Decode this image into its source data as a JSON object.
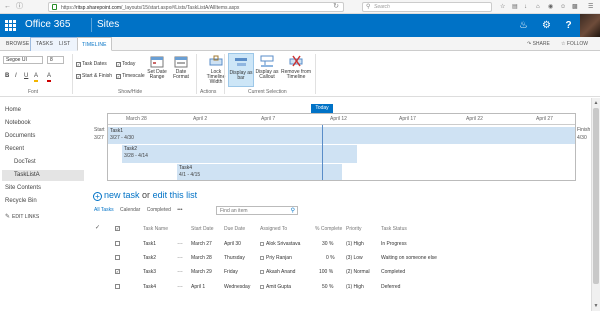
{
  "browser": {
    "url_prefix": "https://",
    "url_host": "ritsp.sharepoint.com",
    "url_path": "/_layouts/15/start.aspx#/Lists/TaskListA/AllItems.aspx",
    "search_placeholder": "Search"
  },
  "suite": {
    "app_name": "Office 365",
    "site_label": "Sites",
    "notification_count": "1",
    "settings_icon": "gear-icon",
    "help_icon": "?"
  },
  "ribbon_tabs": {
    "browse": "BROWSE",
    "tasks": "TASKS",
    "list": "LIST",
    "timeline": "TIMELINE",
    "share": "SHARE",
    "follow": "FOLLOW"
  },
  "ribbon": {
    "font_name": "Segoe UI",
    "font_size": "8",
    "format_labels": [
      "B",
      "I",
      "U",
      "A"
    ],
    "show_hide": {
      "task_dates": "Task Dates",
      "today": "Today",
      "start_finish": "Start & Finish",
      "timescale": "Timescale"
    },
    "buttons": {
      "set_date_range": "Set Date Range",
      "date_format": "Date Format",
      "lock_width": "Lock Timeline Width",
      "display_as_bar": "Display as bar",
      "display_as_callout": "Display as Callout",
      "remove_from_timeline": "Remove from Timeline"
    },
    "groups": {
      "font": "Font",
      "show_hide": "Show/Hide",
      "actions": "Actions",
      "current_selection": "Current Selection"
    }
  },
  "leftnav": {
    "items": [
      "Home",
      "Notebook",
      "Documents",
      "Recent",
      "DocTest",
      "TaskListA",
      "Site Contents",
      "Recycle Bin"
    ],
    "edit_links": "EDIT LINKS"
  },
  "timeline": {
    "today_label": "Today",
    "start_label": "Start",
    "start_date": "3/27",
    "finish_label": "Finish",
    "finish_date": "4/30",
    "dates": [
      "March 28",
      "April 2",
      "April 7",
      "April 12",
      "April 17",
      "April 22",
      "April 27"
    ],
    "tasks": [
      {
        "name": "Task1",
        "dates": "3/27 - 4/30"
      },
      {
        "name": "Task2",
        "dates": "3/28 - 4/14"
      },
      {
        "name": "Task4",
        "dates": "4/1 - 4/15"
      }
    ]
  },
  "list": {
    "new_task": "new task",
    "or_text": "or",
    "edit_list": "edit this list",
    "views": [
      "All Tasks",
      "Calendar",
      "Completed"
    ],
    "more_views": "•••",
    "find_placeholder": "Find an item",
    "columns": [
      "Task Name",
      "Start Date",
      "Due Date",
      "Assigned To",
      "% Complete",
      "Priority",
      "Task Status"
    ],
    "rows": [
      {
        "checked": false,
        "name": "Task1",
        "start": "March 27",
        "due": "April 30",
        "assigned": "Alok Srivastava",
        "complete": "30 %",
        "priority": "(1) High",
        "status": "In Progress"
      },
      {
        "checked": false,
        "name": "Task2",
        "start": "March 28",
        "due": "Thursday",
        "assigned": "Priy Ranjan",
        "complete": "0 %",
        "priority": "(3) Low",
        "status": "Waiting on someone else"
      },
      {
        "checked": true,
        "name": "Task3",
        "start": "March 29",
        "due": "Friday",
        "assigned": "Akash Anand",
        "complete": "100 %",
        "priority": "(2) Normal",
        "status": "Completed"
      },
      {
        "checked": false,
        "name": "Task4",
        "start": "April 1",
        "due": "Wednesday",
        "assigned": "Amit Gupta",
        "complete": "50 %",
        "priority": "(1) High",
        "status": "Deferred"
      }
    ]
  },
  "colors": {
    "suite_blue": "#0072c6",
    "timeline_bar": "#cfe2f3"
  }
}
